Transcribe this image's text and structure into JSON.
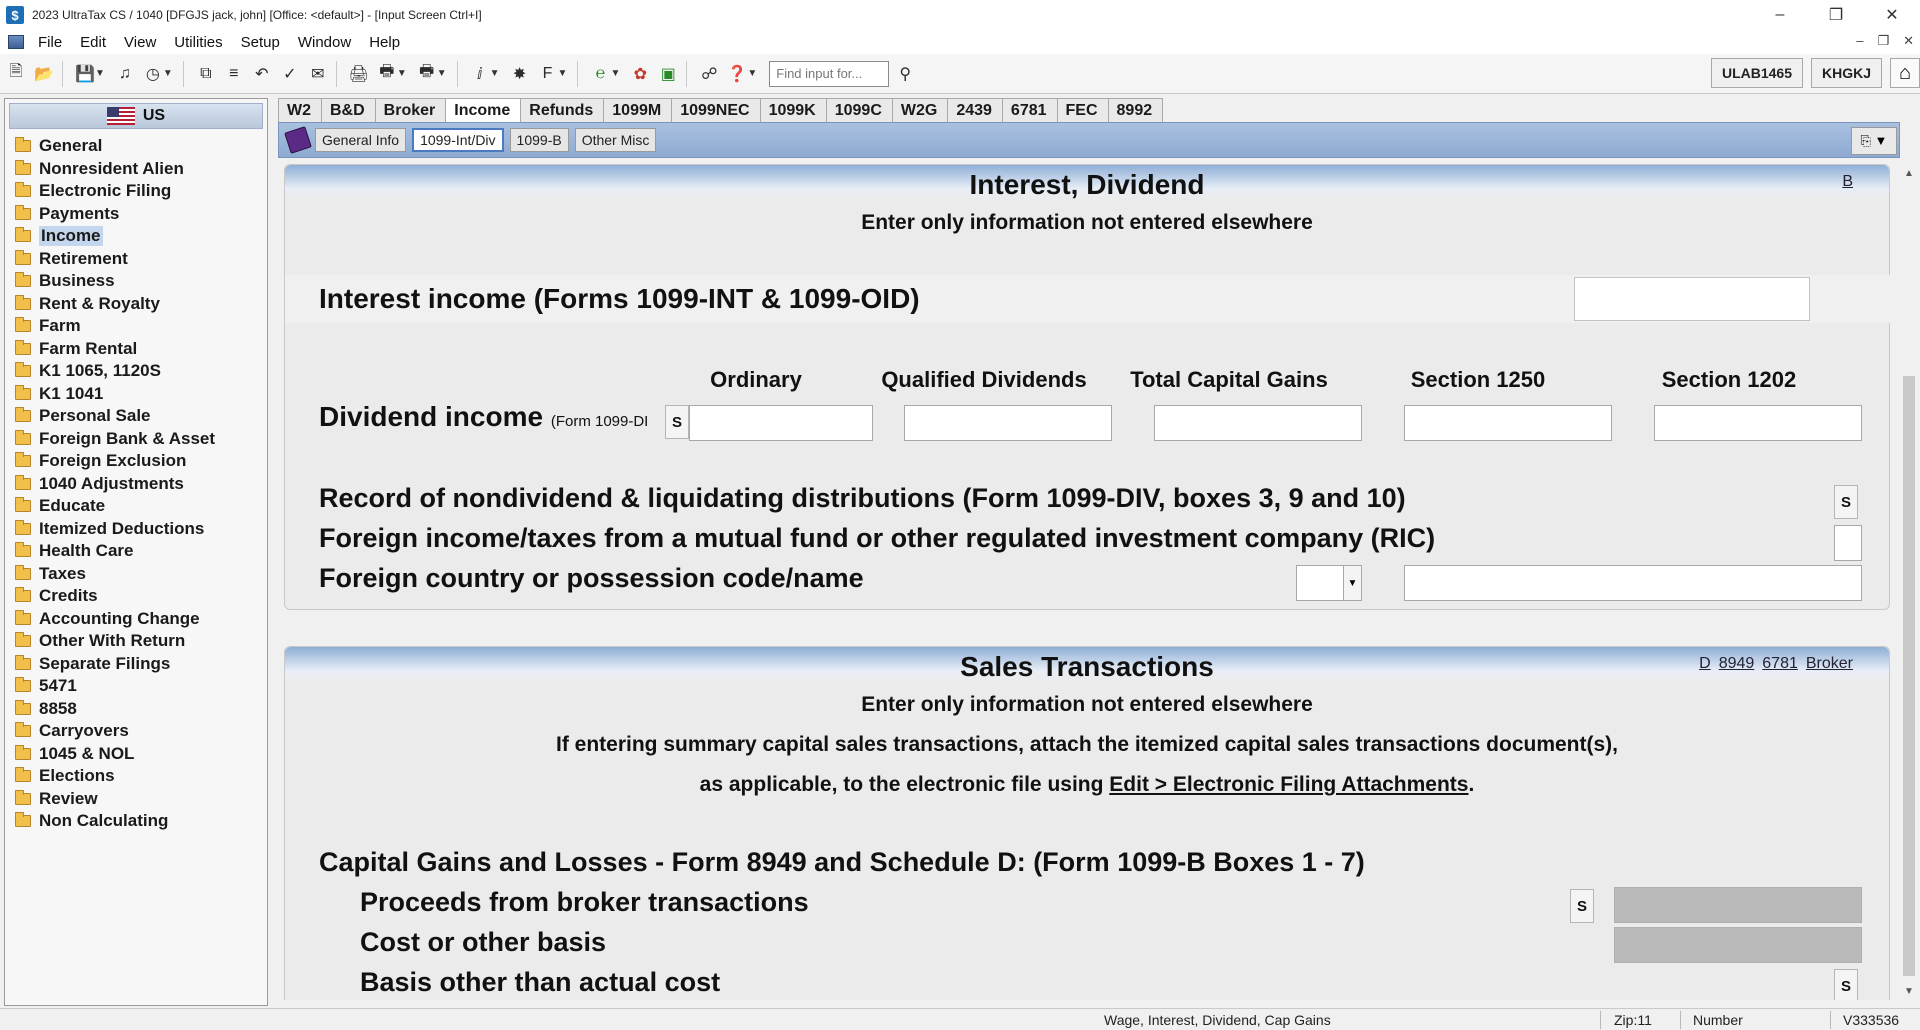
{
  "window": {
    "title": "2023 UltraTax CS  / 1040 [DFGJS jack, john] [Office: <default>] - [Input Screen     Ctrl+I]",
    "app_icon": "$"
  },
  "menu": [
    "File",
    "Edit",
    "View",
    "Utilities",
    "Setup",
    "Window",
    "Help"
  ],
  "toolbar": {
    "find_placeholder": "Find input for...",
    "code1": "ULAB1465",
    "code2": "KHGKJ"
  },
  "sidebar": {
    "header": "US",
    "items": [
      "General",
      "Nonresident Alien",
      "Electronic Filing",
      "Payments",
      "Income",
      "Retirement",
      "Business",
      "Rent & Royalty",
      "Farm",
      "Farm Rental",
      "K1 1065, 1120S",
      "K1 1041",
      "Personal Sale",
      "Foreign Bank & Asset",
      "Foreign Exclusion",
      "1040 Adjustments",
      "Educate",
      "Itemized Deductions",
      "Health Care",
      "Taxes",
      "Credits",
      "Accounting Change",
      "Other With Return",
      "Separate Filings",
      "5471",
      "8858",
      "Carryovers",
      "1045 & NOL",
      "Elections",
      "Review",
      "Non Calculating"
    ],
    "selected": "Income"
  },
  "tabs": [
    "W2",
    "B&D",
    "Broker",
    "Income",
    "Refunds",
    "1099M",
    "1099NEC",
    "1099K",
    "1099C",
    "W2G",
    "2439",
    "6781",
    "FEC",
    "8992"
  ],
  "active_tab": "Income",
  "subtabs": [
    "General Info",
    "1099-Int/Div",
    "1099-B",
    "Other Misc"
  ],
  "active_subtab": "1099-Int/Div",
  "section1": {
    "title": "Interest, Dividend",
    "link": "B",
    "subtitle": "Enter only information not entered elsewhere",
    "interest_label": "Interest income (Forms 1099-INT & 1099-OID)",
    "col_headers": [
      "Ordinary",
      "Qualified Dividends",
      "Total Capital Gains",
      "Section 1250",
      "Section 1202"
    ],
    "dividend_label": "Dividend income",
    "dividend_sub": "(Form 1099-DI",
    "s": "S",
    "nondividend_label": "Record of nondividend & liquidating distributions (Form 1099-DIV, boxes 3, 9 and 10)",
    "foreign_ric_label": "Foreign income/taxes from a mutual fund or other regulated investment company (RIC)",
    "foreign_country_label": "Foreign country or possession code/name"
  },
  "section2": {
    "title": "Sales Transactions",
    "links": [
      "D",
      "8949",
      "6781",
      "Broker"
    ],
    "subtitle": "Enter only information not entered elsewhere",
    "note1": "If entering summary capital sales transactions, attach the itemized capital sales transactions document(s),",
    "note2_pre": "as applicable, to the electronic file using ",
    "note2_link": "Edit > Electronic Filing Attachments",
    "note2_post": ".",
    "capital_label": "Capital Gains and Losses - Form 8949 and Schedule D: (Form 1099-B Boxes 1 - 7)",
    "proceeds_label": "Proceeds from broker transactions",
    "cost_label": "Cost or other basis",
    "basis_label": "Basis other than actual cost"
  },
  "statusbar": {
    "description": "Wage, Interest, Dividend, Cap Gains",
    "zip": "Zip:11",
    "mode": "Number",
    "version": "V333536"
  }
}
